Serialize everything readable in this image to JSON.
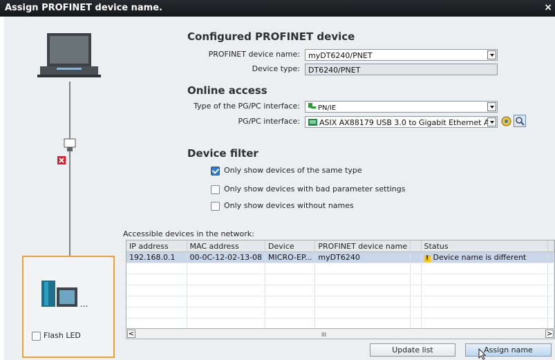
{
  "window": {
    "title": "Assign PROFINET device name.",
    "close_glyph": "×"
  },
  "configured": {
    "heading": "Configured PROFINET device",
    "name_label": "PROFINET device name:",
    "name_value": "myDT6240/PNET",
    "type_label": "Device type:",
    "type_value": "DT6240/PNET"
  },
  "online": {
    "heading": "Online access",
    "iface_type_label": "Type of the PG/PC interface:",
    "iface_type_value": "PN/IE",
    "iface_label": "PG/PC interface:",
    "iface_value": "ASIX AX88179 USB 3.0 to Gigabit Ethernet A..."
  },
  "filter": {
    "heading": "Device filter",
    "options": [
      {
        "label": "Only show devices of the same type",
        "checked": true
      },
      {
        "label": "Only show devices with bad parameter settings",
        "checked": false
      },
      {
        "label": "Only show devices without names",
        "checked": false
      }
    ]
  },
  "network": {
    "caption": "Accessible devices in the network:",
    "columns": [
      "IP address",
      "MAC address",
      "Device",
      "PROFINET device name",
      "Status"
    ],
    "rows": [
      {
        "ip": "192.168.0.1",
        "mac": "00-0C-12-02-13-08",
        "device": "MICRO-EP...",
        "name": "myDT6240",
        "status": "Device name is different"
      }
    ]
  },
  "scroll_thumb_glyph": "III",
  "scroll_left_glyph": "<",
  "scroll_right_glyph": ">",
  "flash_led_label": "Flash LED",
  "buttons": {
    "update": "Update list",
    "assign": "Assign name"
  },
  "colors": {
    "accent_orange": "#f0a030",
    "error_red": "#d9202a",
    "warning_yellow": "#f2c418",
    "selection_blue": "#c9d6ea"
  }
}
